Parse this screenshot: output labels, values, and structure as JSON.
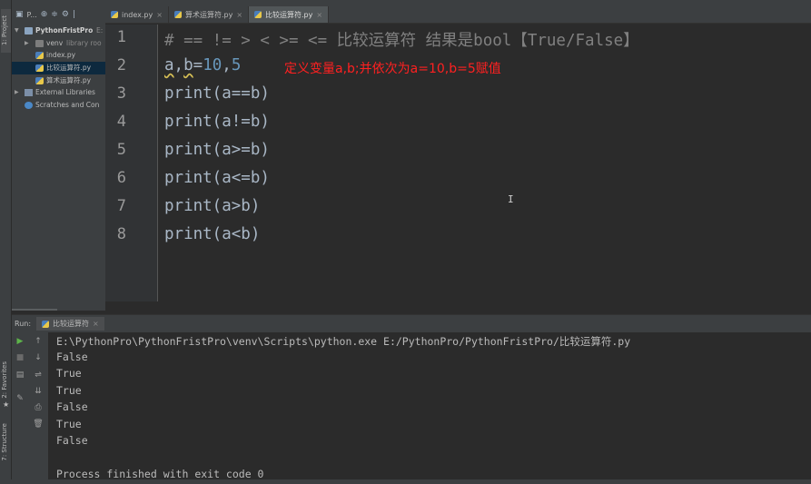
{
  "side_tabs": {
    "project": "1: Project",
    "favorites": "2: Favorites",
    "structure": "7: Structure"
  },
  "project_panel": {
    "header_label": "P...",
    "tree": [
      {
        "label": "PythonFristPro",
        "suffix": "E:",
        "kind": "root"
      },
      {
        "label": "venv",
        "suffix": "library roo",
        "kind": "folder"
      },
      {
        "label": "index.py",
        "kind": "file"
      },
      {
        "label": "比较运算符.py",
        "kind": "file",
        "selected": true
      },
      {
        "label": "算术运算符.py",
        "kind": "file"
      },
      {
        "label": "External Libraries",
        "kind": "lib"
      },
      {
        "label": "Scratches and Con",
        "kind": "scratch"
      }
    ]
  },
  "tabs": [
    {
      "label": "index.py"
    },
    {
      "label": "算术运算符.py"
    },
    {
      "label": "比较运算符.py",
      "active": true
    }
  ],
  "editor": {
    "line_numbers": [
      "1",
      "2",
      "3",
      "4",
      "5",
      "6",
      "7",
      "8"
    ],
    "lines": {
      "l1": "# == != > < >= <= 比较运算符 结果是bool【True/False】",
      "l2_a": "a",
      "l2_comma1": ",",
      "l2_b": "b",
      "l2_eq": "=",
      "l2_ten": "10",
      "l2_comma2": ",",
      "l2_five": "5",
      "l3": "print(a==b)",
      "l4": "print(a!=b)",
      "l5": "print(a>=b)",
      "l6": "print(a<=b)",
      "l7": "print(a>b)",
      "l8": "print(a<b)"
    },
    "annotation": "定义变量a,b;并依次为a=10,b=5赋值",
    "mouse_cursor": "I"
  },
  "run_panel": {
    "label": "Run:",
    "tab_label": "比较运算符",
    "console": [
      "E:\\PythonPro\\PythonFristPro\\venv\\Scripts\\python.exe E:/PythonPro/PythonFristPro/比较运算符.py",
      "False",
      "True",
      "True",
      "False",
      "True",
      "False",
      "",
      "Process finished with exit code 0"
    ]
  },
  "colors": {
    "background": "#2b2b2b",
    "panel": "#3c3f41",
    "annotation": "#ff2020",
    "keyword": "#8888c6",
    "number": "#6897bb",
    "comment": "#808080"
  }
}
